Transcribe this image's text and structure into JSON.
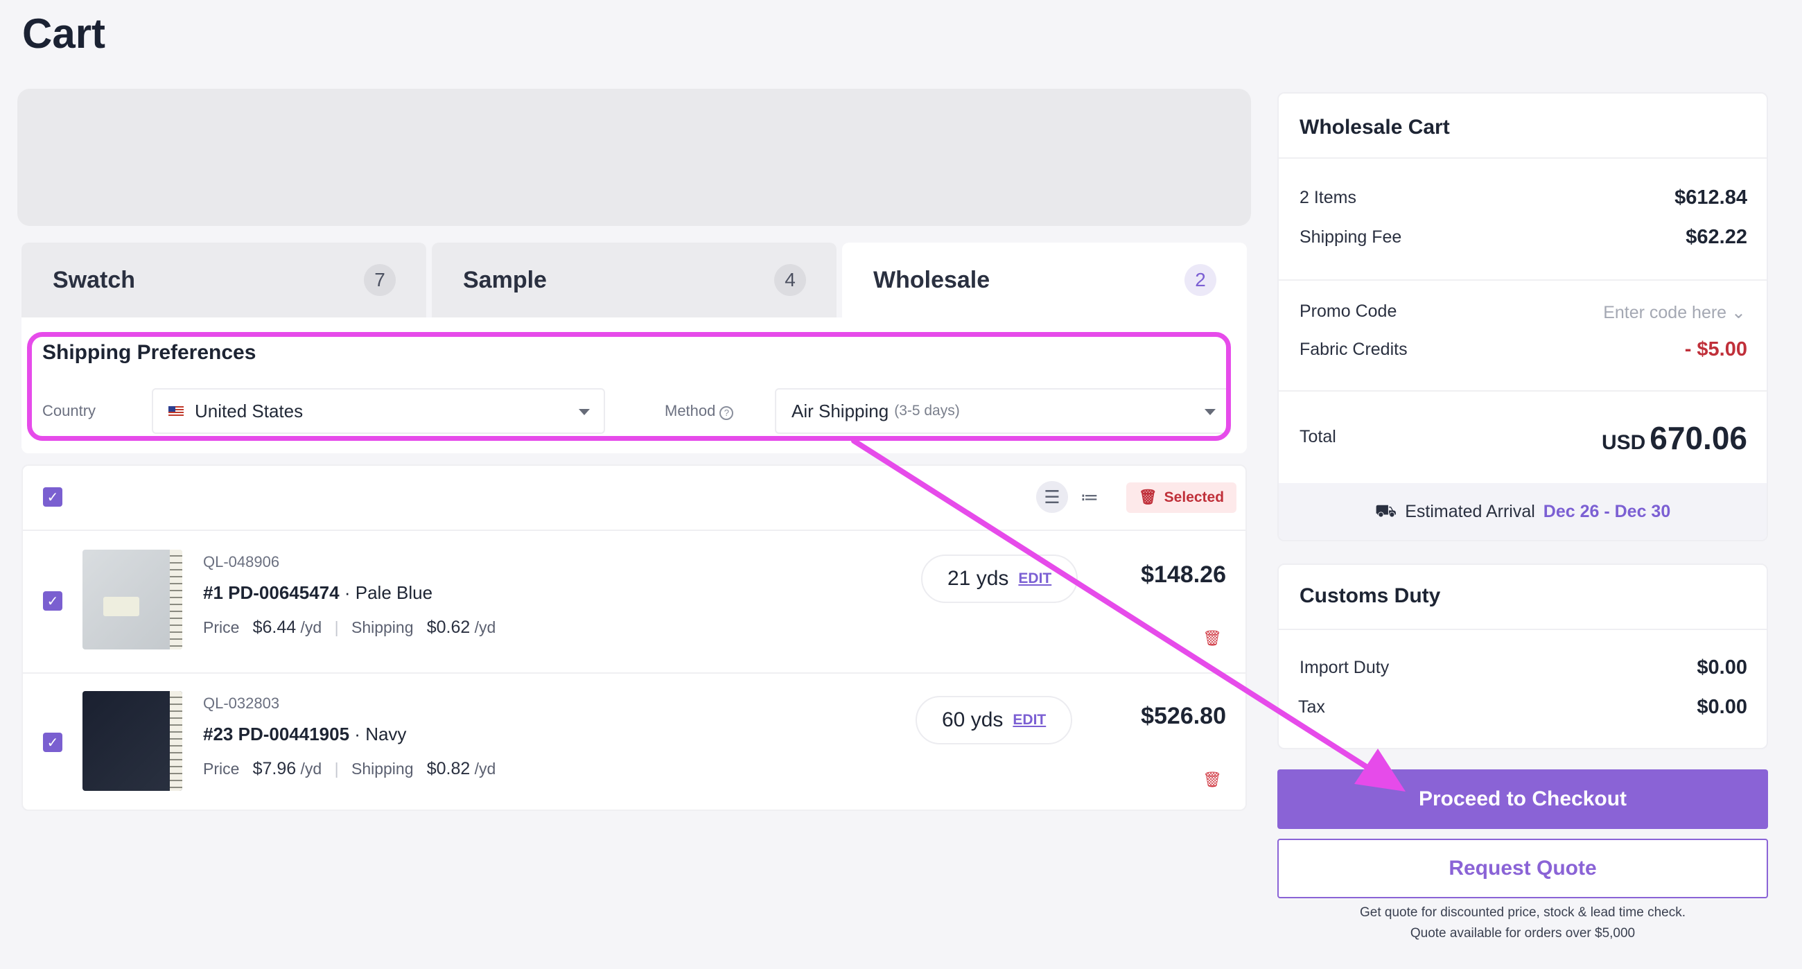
{
  "page": {
    "title": "Cart"
  },
  "tabs": [
    {
      "label": "Swatch",
      "count": "7"
    },
    {
      "label": "Sample",
      "count": "4"
    },
    {
      "label": "Wholesale",
      "count": "2"
    }
  ],
  "shipping": {
    "title": "Shipping Preferences",
    "country_label": "Country",
    "country_value": "United States",
    "method_label": "Method",
    "method_value": "Air Shipping",
    "method_hint": "(3-5 days)"
  },
  "list": {
    "selected_label": "Selected",
    "items": [
      {
        "sku": "QL-048906",
        "name": "#1 PD-00645474",
        "color": "Pale Blue",
        "price_label": "Price",
        "price": "$6.44",
        "price_unit": "/yd",
        "shipping_label": "Shipping",
        "shipping": "$0.62",
        "shipping_unit": "/yd",
        "qty": "21 yds",
        "edit": "EDIT",
        "total": "$148.26"
      },
      {
        "sku": "QL-032803",
        "name": "#23 PD-00441905",
        "color": "Navy",
        "price_label": "Price",
        "price": "$7.96",
        "price_unit": "/yd",
        "shipping_label": "Shipping",
        "shipping": "$0.82",
        "shipping_unit": "/yd",
        "qty": "60 yds",
        "edit": "EDIT",
        "total": "$526.80"
      }
    ]
  },
  "summary": {
    "title": "Wholesale Cart",
    "items_label": "2 Items",
    "items_value": "$612.84",
    "shipping_label": "Shipping Fee",
    "shipping_value": "$62.22",
    "promo_label": "Promo Code",
    "promo_placeholder": "Enter code here",
    "credits_label": "Fabric Credits",
    "credits_value": "- $5.00",
    "total_label": "Total",
    "total_currency": "USD",
    "total_value": "670.06",
    "arrival_label": "Estimated Arrival",
    "arrival_dates": "Dec 26 - Dec 30"
  },
  "duty": {
    "title": "Customs Duty",
    "import_label": "Import Duty",
    "import_value": "$0.00",
    "tax_label": "Tax",
    "tax_value": "$0.00"
  },
  "actions": {
    "checkout": "Proceed to Checkout",
    "quote": "Request Quote",
    "note_1": "Get quote for discounted price, stock & lead time check.",
    "note_2": "Quote available for orders over $5,000"
  },
  "colors": {
    "accent": "#8a63d6",
    "highlight": "#e64bea",
    "danger": "#c0303a"
  }
}
